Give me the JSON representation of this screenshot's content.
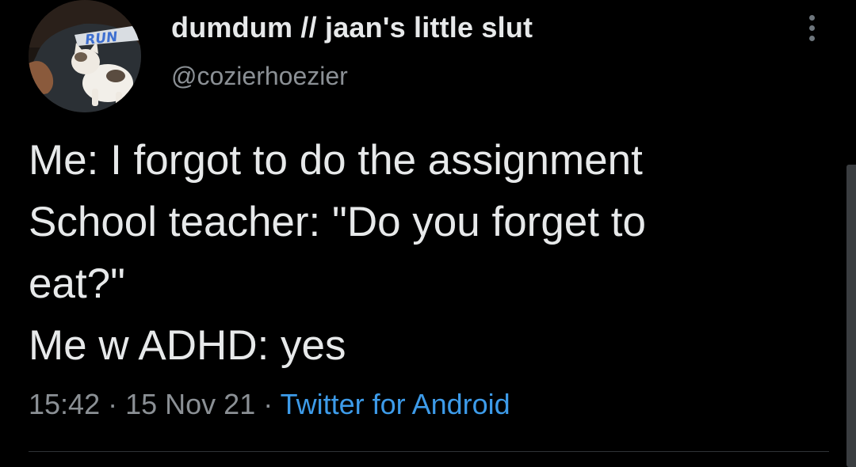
{
  "author": {
    "display_name": "dumdum // jaan's little slut",
    "handle": "@cozierhoezier",
    "avatar_shirt_text": "RUN"
  },
  "tweet": {
    "lines": [
      "Me: I forgot to do the assignment",
      "School teacher: \"Do you forget to",
      "eat?\"",
      "Me w ADHD: yes"
    ]
  },
  "meta": {
    "time": "15:42",
    "separator": "·",
    "date": "15 Nov 21",
    "source": "Twitter for Android"
  },
  "colors": {
    "background": "#000000",
    "primary_text": "#e7e9ea",
    "secondary_text": "#8b9095",
    "link": "#3d9be9",
    "divider": "#2f3336"
  },
  "icons": {
    "more": "more-vertical-icon"
  }
}
